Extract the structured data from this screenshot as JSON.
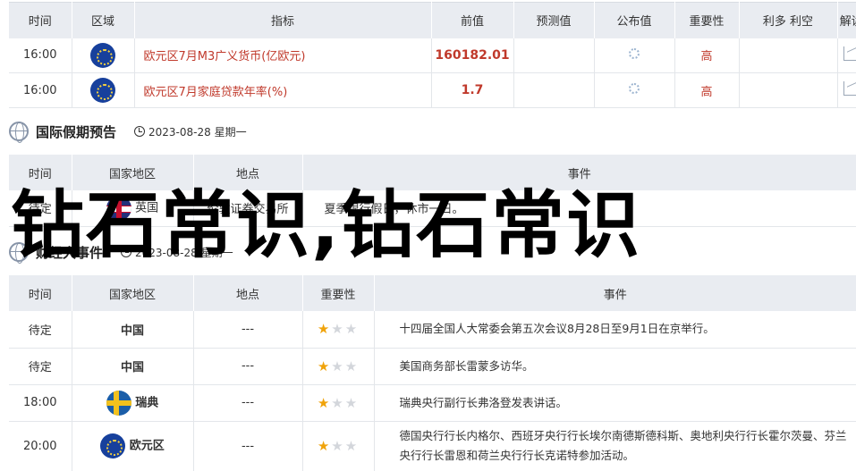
{
  "top_table": {
    "headers": [
      "时间",
      "区域",
      "指标",
      "前值",
      "预测值",
      "公布值",
      "重要性",
      "利多 利空",
      "解读"
    ],
    "rows": [
      {
        "time": "16:00",
        "indicator": "欧元区7月M3广义货币(亿欧元)",
        "prev": "160182.01",
        "importance": "高"
      },
      {
        "time": "16:00",
        "indicator": "欧元区7月家庭贷款年率(%)",
        "prev": "1.7",
        "importance": "高"
      }
    ]
  },
  "holiday": {
    "title": "国际假期预告",
    "date": "2023-08-28 星期一",
    "headers": [
      "时间",
      "国家地区",
      "地点",
      "事件"
    ],
    "row": {
      "time": "待定",
      "country": "英国",
      "place": "伦敦证券交易所",
      "event": "夏季银行假日，休市一日。"
    }
  },
  "events": {
    "title": "财经大事件",
    "date": "2023-08-28 星期一",
    "headers": [
      "时间",
      "国家地区",
      "地点",
      "重要性",
      "事件"
    ],
    "rows": [
      {
        "time": "待定",
        "country": "中国",
        "place": "---",
        "event": "十四届全国人大常委会第五次会议8月28日至9月1日在京举行。"
      },
      {
        "time": "待定",
        "country": "中国",
        "place": "---",
        "event": "美国商务部长雷蒙多访华。"
      },
      {
        "time": "18:00",
        "country": "瑞典",
        "place": "---",
        "event": "瑞典央行副行长弗洛登发表讲话。"
      },
      {
        "time": "20:00",
        "country": "欧元区",
        "place": "---",
        "event": "德国央行行长内格尔、西班牙央行行长埃尔南德斯德科斯、奥地利央行行长霍尔茨曼、芬兰央行行长雷恩和荷兰央行行长克诺特参加活动。"
      }
    ],
    "stars": "★★★",
    "star_rating": 1
  },
  "watermark": "钻石常识,钻石常识",
  "colors": {
    "accent_red": "#c0392b",
    "header_bg": "#e9ecf1",
    "star": "#f0a30a"
  }
}
